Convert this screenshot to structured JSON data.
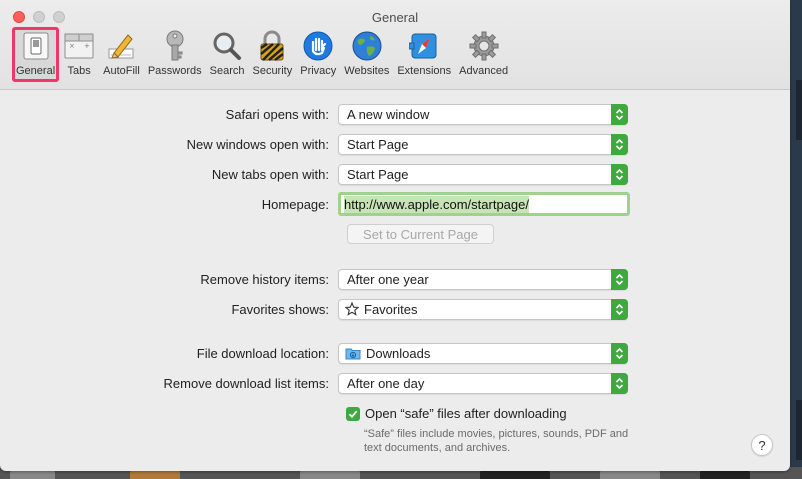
{
  "window": {
    "title": "General"
  },
  "toolbar": {
    "items": [
      {
        "label": "General",
        "icon": "general-switch-icon",
        "selected": true
      },
      {
        "label": "Tabs",
        "icon": "tabs-icon"
      },
      {
        "label": "AutoFill",
        "icon": "autofill-pencil-icon"
      },
      {
        "label": "Passwords",
        "icon": "key-icon"
      },
      {
        "label": "Search",
        "icon": "magnifier-icon"
      },
      {
        "label": "Security",
        "icon": "padlock-icon"
      },
      {
        "label": "Privacy",
        "icon": "hand-icon"
      },
      {
        "label": "Websites",
        "icon": "globe-icon"
      },
      {
        "label": "Extensions",
        "icon": "compass-puzzle-icon"
      },
      {
        "label": "Advanced",
        "icon": "gear-icon"
      }
    ],
    "selected_color": "#f0366a"
  },
  "general": {
    "safari_opens": {
      "label": "Safari opens with:",
      "value": "A new window"
    },
    "new_windows": {
      "label": "New windows open with:",
      "value": "Start Page"
    },
    "new_tabs": {
      "label": "New tabs open with:",
      "value": "Start Page"
    },
    "homepage": {
      "label": "Homepage:",
      "value": "http://www.apple.com/startpage/"
    },
    "set_current_label": "Set to Current Page",
    "remove_history": {
      "label": "Remove history items:",
      "value": "After one year"
    },
    "favorites_shows": {
      "label": "Favorites shows:",
      "value": "Favorites"
    },
    "download_location": {
      "label": "File download location:",
      "value": "Downloads"
    },
    "remove_download": {
      "label": "Remove download list items:",
      "value": "After one day"
    },
    "open_safe": {
      "label": "Open “safe” files after downloading",
      "checked": true
    },
    "safe_note": "“Safe” files include movies, pictures, sounds, PDF and text documents, and archives.",
    "help": "?"
  },
  "colors": {
    "accent": "#3eaa3e",
    "close": "#fc605b"
  }
}
